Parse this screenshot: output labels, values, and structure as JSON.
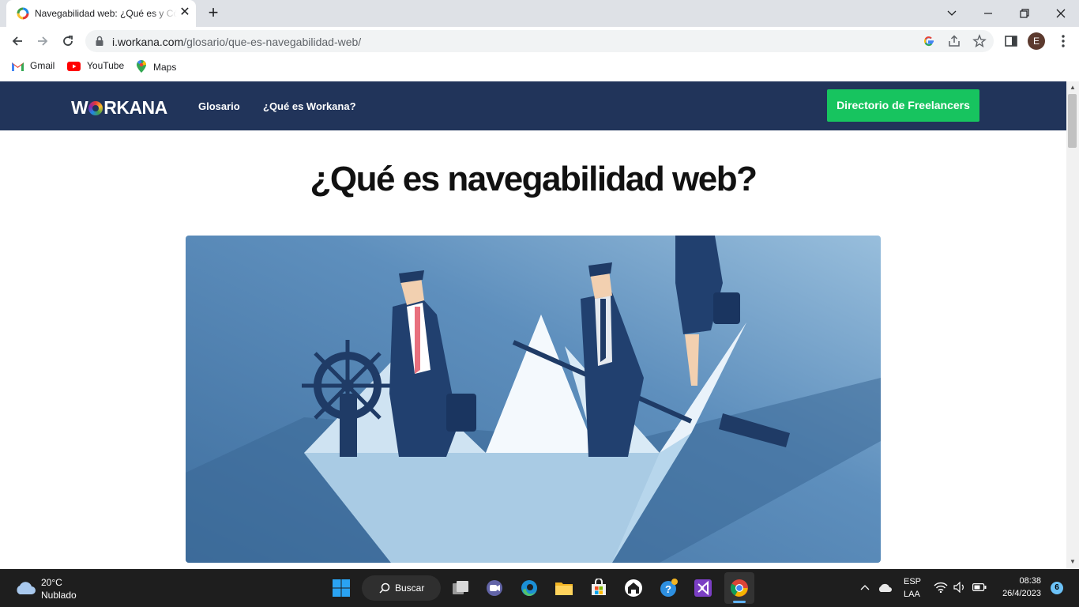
{
  "browser": {
    "tab_title": "Navegabilidad web: ¿Qué es y Cómo mejorarla?",
    "url_host": "i.workana.com",
    "url_path": "/glosario/que-es-navegabilidad-web/",
    "avatar_letter": "E",
    "bookmarks": [
      {
        "label": "Gmail",
        "icon": "gmail-icon"
      },
      {
        "label": "YouTube",
        "icon": "youtube-icon"
      },
      {
        "label": "Maps",
        "icon": "maps-icon"
      }
    ]
  },
  "site": {
    "logo_prefix": "W",
    "logo_suffix": "RKANA",
    "nav": [
      {
        "label": "Glosario"
      },
      {
        "label": "¿Qué es Workana?"
      }
    ],
    "cta_label": "Directorio de Freelancers",
    "header_color": "#21345a",
    "cta_color": "#17c45f"
  },
  "article": {
    "title": "¿Qué es navegabilidad web?",
    "hero_image": "businesspeople-on-paper-boat-illustration"
  },
  "taskbar": {
    "weather_temp": "20°C",
    "weather_desc": "Nublado",
    "search_label": "Buscar",
    "lang_line1": "ESP",
    "lang_line2": "LAA",
    "time": "08:38",
    "date": "26/4/2023",
    "notifications": "6"
  }
}
